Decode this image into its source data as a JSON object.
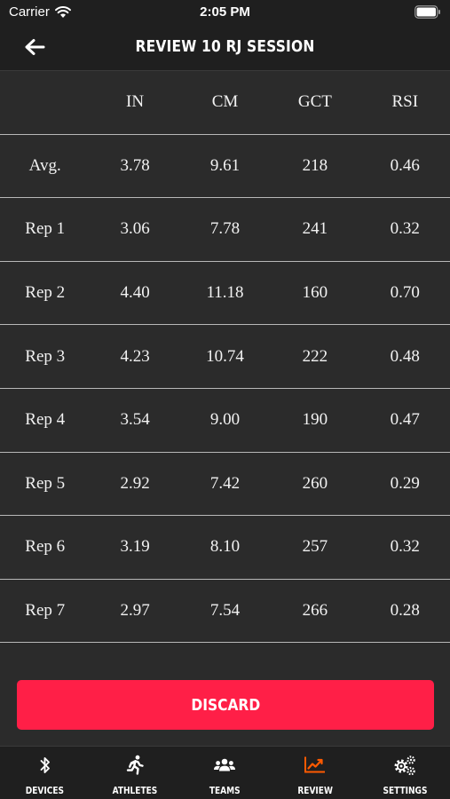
{
  "status_bar": {
    "carrier": "Carrier",
    "time": "2:05 PM"
  },
  "nav": {
    "title": "REVIEW 10 RJ SESSION"
  },
  "table": {
    "columns": [
      "",
      "IN",
      "CM",
      "GCT",
      "RSI"
    ],
    "rows": [
      [
        "Avg.",
        "3.78",
        "9.61",
        "218",
        "0.46"
      ],
      [
        "Rep 1",
        "3.06",
        "7.78",
        "241",
        "0.32"
      ],
      [
        "Rep 2",
        "4.40",
        "11.18",
        "160",
        "0.70"
      ],
      [
        "Rep 3",
        "4.23",
        "10.74",
        "222",
        "0.48"
      ],
      [
        "Rep 4",
        "3.54",
        "9.00",
        "190",
        "0.47"
      ],
      [
        "Rep 5",
        "2.92",
        "7.42",
        "260",
        "0.29"
      ],
      [
        "Rep 6",
        "3.19",
        "8.10",
        "257",
        "0.32"
      ],
      [
        "Rep 7",
        "2.97",
        "7.54",
        "266",
        "0.28"
      ]
    ]
  },
  "discard_label": "DISCARD",
  "tabs": [
    {
      "label": "DEVICES",
      "icon": "bluetooth-icon",
      "active": false
    },
    {
      "label": "ATHLETES",
      "icon": "runner-icon",
      "active": false
    },
    {
      "label": "TEAMS",
      "icon": "users-icon",
      "active": false
    },
    {
      "label": "REVIEW",
      "icon": "chart-icon",
      "active": true
    },
    {
      "label": "SETTINGS",
      "icon": "gears-icon",
      "active": false
    }
  ],
  "colors": {
    "accent": "#ff1f47",
    "active_tab": "#ff5a00",
    "background": "#2b2b2b",
    "bar": "#1f1f1f"
  }
}
